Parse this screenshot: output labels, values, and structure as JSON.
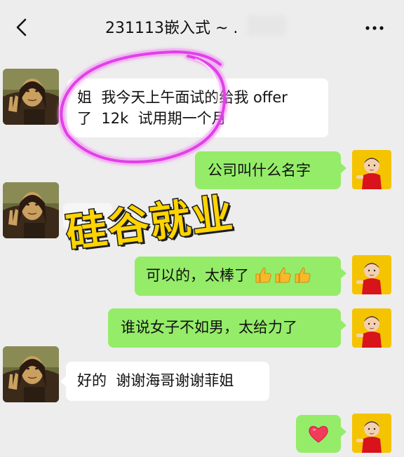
{
  "header": {
    "title": "231113嵌入式 ~ ."
  },
  "messages": [
    {
      "side": "left",
      "sender": "mona-lisa-avatar",
      "lines": [
        "姐  我今天上午面试的给我 offer",
        "了  12k  试用期一个月"
      ]
    },
    {
      "side": "right",
      "sender": "kid-avatar",
      "text": "公司叫什么名字"
    },
    {
      "side": "right",
      "sender": "kid-avatar",
      "text": "可以的，太棒了",
      "emoji": "thumbs-up x3"
    },
    {
      "side": "right",
      "sender": "kid-avatar",
      "text": "谁说女子不如男，太给力了"
    },
    {
      "side": "left",
      "sender": "mona-lisa-avatar",
      "text": "好的  谢谢海哥谢谢菲姐"
    },
    {
      "side": "right",
      "sender": "kid-avatar",
      "emoji": "heart"
    }
  ],
  "watermark": {
    "text": "硅谷就业"
  },
  "colors": {
    "background": "#ededed",
    "sent_bubble": "#95ec69",
    "received_bubble": "#ffffff",
    "highlight": "#e040e8",
    "watermark_fill": "#ffd400",
    "watermark_outline": "#1c1c1c"
  }
}
